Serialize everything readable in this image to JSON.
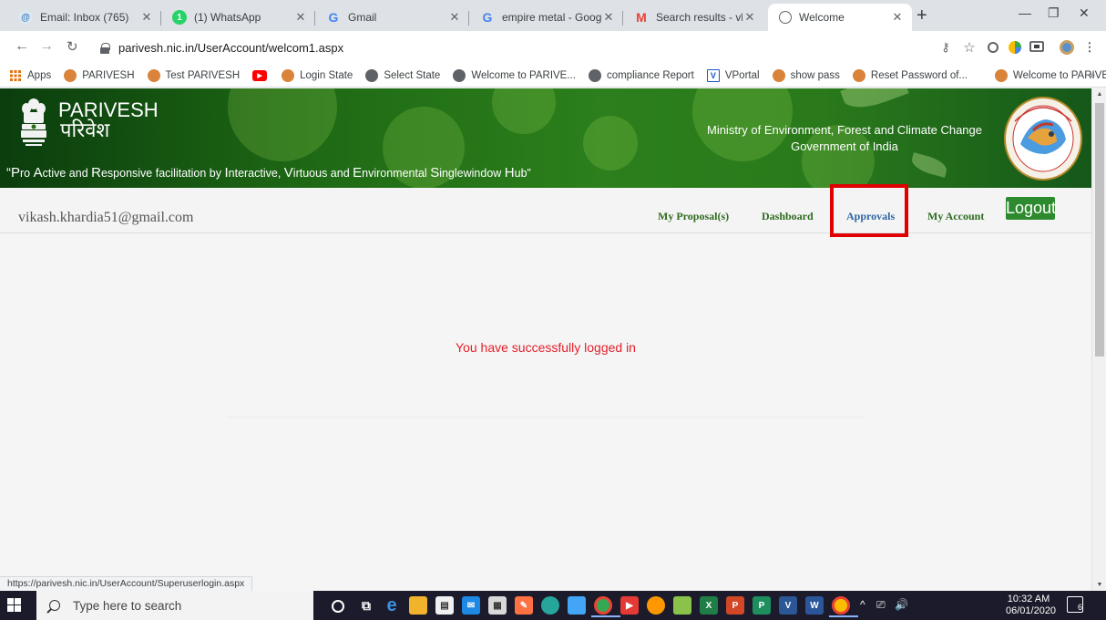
{
  "browser": {
    "tabs": [
      {
        "title": "Email: Inbox (765)",
        "icon": "email-icon",
        "color": "#5f9ea0"
      },
      {
        "title": "(1) WhatsApp",
        "icon": "whatsapp-icon",
        "color": "#25d366"
      },
      {
        "title": "Gmail",
        "icon": "google-icon",
        "color": "#4285f4"
      },
      {
        "title": "empire metal - Google",
        "icon": "google-icon",
        "color": "#4285f4"
      },
      {
        "title": "Search results - vkb.nic",
        "icon": "gmail-icon",
        "color": "#ea4335"
      },
      {
        "title": "Welcome",
        "icon": "globe-icon",
        "color": "#5f6368",
        "active": true
      }
    ],
    "new_tab": "+",
    "window_controls": {
      "minimize": "—",
      "maximize": "❐",
      "close": "✕"
    },
    "url": "parivesh.nic.in/UserAccount/welcom1.aspx",
    "bookmarks": [
      {
        "label": "Apps",
        "icon": "apps-grid-icon",
        "color": "#e8710a"
      },
      {
        "label": "PARIVESH",
        "icon": "parivesh-icon",
        "color": "#e37400"
      },
      {
        "label": "Test PARIVESH",
        "icon": "parivesh-icon",
        "color": "#e37400"
      },
      {
        "label": "",
        "icon": "youtube-icon",
        "color": "#ff0000"
      },
      {
        "label": "Login State",
        "icon": "parivesh-icon",
        "color": "#e37400"
      },
      {
        "label": "Select State",
        "icon": "globe-icon",
        "color": "#5f6368"
      },
      {
        "label": "Welcome to PARIVE...",
        "icon": "globe-icon",
        "color": "#5f6368"
      },
      {
        "label": "compliance Report",
        "icon": "globe-icon",
        "color": "#5f6368"
      },
      {
        "label": "VPortal",
        "icon": "vportal-icon",
        "color": "#1a56c9"
      },
      {
        "label": "show pass",
        "icon": "parivesh-icon",
        "color": "#e37400"
      },
      {
        "label": "Reset Password of...",
        "icon": "parivesh-icon",
        "color": "#e37400"
      },
      {
        "label": "Welcome to PARIVE...",
        "icon": "parivesh-icon",
        "color": "#e37400"
      }
    ],
    "bookmarks_overflow": "»",
    "status_url": "https://parivesh.nic.in/UserAccount/Superuserlogin.aspx"
  },
  "header": {
    "site_name": "PARIVESH",
    "site_name_hindi": "परिवेश",
    "tagline": [
      {
        "big": "“P",
        "rest": "ro "
      },
      {
        "big": "A",
        "rest": "ctive and "
      },
      {
        "big": "R",
        "rest": "esponsive facilitation by "
      },
      {
        "big": "I",
        "rest": "nteractive, "
      },
      {
        "big": "V",
        "rest": "irtuous and "
      },
      {
        "big": "E",
        "rest": "nvironmental "
      },
      {
        "big": "S",
        "rest": "ingle"
      },
      {
        "big": "",
        "rest": "window "
      },
      {
        "big": "H",
        "rest": "ub”"
      }
    ],
    "ministry_line1": "Ministry of Environment, Forest and Climate Change",
    "ministry_line2": "Government of India"
  },
  "userbar": {
    "email": "vikash.khardia51@gmail.com",
    "menu": {
      "proposals": "My Proposal(s)",
      "dashboard": "Dashboard",
      "approvals": "Approvals",
      "account": "My Account"
    },
    "logout": "Logout"
  },
  "main": {
    "message": "You have successfully logged in"
  },
  "taskbar": {
    "search_placeholder": "Type here to search",
    "time": "10:32 AM",
    "date": "06/01/2020",
    "notification_count": "6",
    "tray_chevron": "^"
  },
  "colors": {
    "banner_green": "#2c7f1c",
    "menu_green": "#2e6b1f",
    "approvals_blue": "#2e65a6",
    "highlight_red": "#e00000",
    "message_red": "#e3202a",
    "logout_green": "#2e8a2e"
  }
}
